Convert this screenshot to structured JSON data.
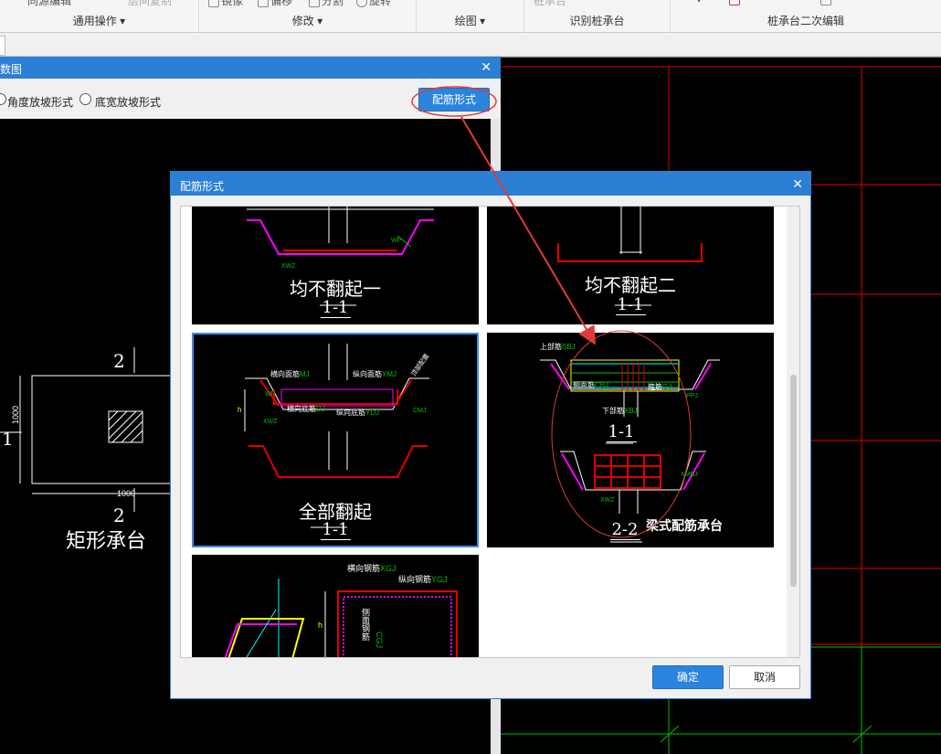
{
  "ribbon": {
    "groups": [
      {
        "label": "通用操作",
        "has_dropdown": true
      },
      {
        "label": "修改",
        "has_dropdown": true
      },
      {
        "label": "绘图",
        "has_dropdown": true
      },
      {
        "label": "识别桩承台",
        "has_dropdown": false
      },
      {
        "label": "桩承台二次编辑",
        "has_dropdown": false
      }
    ],
    "cut_top_texts": [
      "同源编辑",
      "层间复制",
      "镜像",
      "偏移",
      "分割",
      "旋转",
      "桩承台"
    ],
    "dropdown_glyph": "▾"
  },
  "dialog_param": {
    "title_fragment": "数图",
    "close_glyph": "✕",
    "radio_angle": "角度放坡形式",
    "radio_width": "底宽放坡形式",
    "rebar_button": "配筋形式",
    "drawing": {
      "top_number": "2",
      "bottom_number": "2",
      "left_number": "1",
      "dim_width": "1000",
      "dim_height": "1000",
      "caption": "矩形承台"
    }
  },
  "dialog_rebar": {
    "title": "配筋形式",
    "close_glyph": "✕",
    "options": [
      {
        "caption": "均不翻起一",
        "section": "1-1",
        "selected": false,
        "labels": [
          "XWZ",
          "WP"
        ]
      },
      {
        "caption": "均不翻起二",
        "section": "1-1",
        "selected": false,
        "labels": []
      },
      {
        "caption": "全部翻起",
        "section": "1-1",
        "selected": true,
        "labels": [
          "横向面筋",
          "MJ",
          "纵向面筋",
          "YMJ",
          "横向底筋",
          "DJ",
          "纵向底筋",
          "YDJ",
          "WP",
          "XWZ",
          "CMJ",
          "h",
          "顶部配置"
        ]
      },
      {
        "caption": "梁式配筋承台",
        "section": "1-1",
        "section2": "2-2",
        "selected": false,
        "labels": [
          "上部筋",
          "SBJ",
          "侧面筋",
          "CBJ",
          "箍筋",
          "GJ",
          "下部筋",
          "XBJ",
          "PPJ",
          "XWZ",
          "XMBJ"
        ]
      },
      {
        "caption": "",
        "section": "",
        "selected": false,
        "labels": [
          "横向钢筋",
          "XGJ",
          "纵向钢筋",
          "YGJ",
          "侧面钢筋",
          "CGJ",
          "h"
        ]
      }
    ],
    "ok_button": "确定",
    "cancel_button": "取消"
  },
  "colors": {
    "title_bar": "#2b7fd4",
    "accent_button": "#2b85de",
    "annotation": "#e03a3a",
    "cad_red": "#e00000",
    "cad_green": "#00c000",
    "cad_magenta": "#ff00ff",
    "cad_yellow": "#ffff00",
    "cad_cyan": "#00ffff"
  }
}
